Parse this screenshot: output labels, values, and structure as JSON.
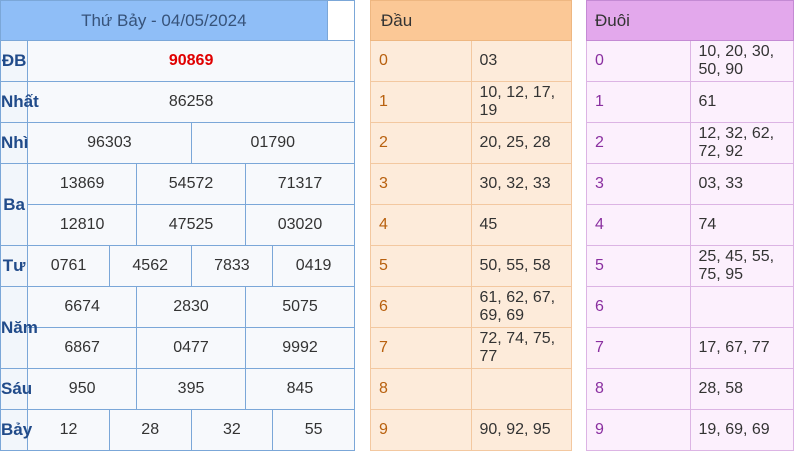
{
  "results": {
    "title": "Thứ Bảy - 04/05/2024",
    "rows": {
      "db": {
        "label": "ĐB",
        "values": [
          "90869"
        ]
      },
      "nhat": {
        "label": "Nhất",
        "values": [
          "86258"
        ]
      },
      "nhi": {
        "label": "Nhì",
        "values": [
          "96303",
          "01790"
        ]
      },
      "ba": {
        "label": "Ba",
        "values": [
          "13869",
          "54572",
          "71317",
          "12810",
          "47525",
          "03020"
        ]
      },
      "tu": {
        "label": "Tư",
        "values": [
          "0761",
          "4562",
          "7833",
          "0419"
        ]
      },
      "nam": {
        "label": "Năm",
        "values": [
          "6674",
          "2830",
          "5075",
          "6867",
          "0477",
          "9992"
        ]
      },
      "sau": {
        "label": "Sáu",
        "values": [
          "950",
          "395",
          "845"
        ]
      },
      "bay": {
        "label": "Bảy",
        "values": [
          "12",
          "28",
          "32",
          "55"
        ]
      }
    }
  },
  "dau": {
    "header": "Đầu",
    "rows": [
      {
        "idx": "0",
        "vals": "03"
      },
      {
        "idx": "1",
        "vals": "10, 12, 17, 19"
      },
      {
        "idx": "2",
        "vals": "20, 25, 28"
      },
      {
        "idx": "3",
        "vals": "30, 32, 33"
      },
      {
        "idx": "4",
        "vals": "45"
      },
      {
        "idx": "5",
        "vals": "50, 55, 58"
      },
      {
        "idx": "6",
        "vals": "61, 62, 67, 69, 69"
      },
      {
        "idx": "7",
        "vals": "72, 74, 75, 77"
      },
      {
        "idx": "8",
        "vals": ""
      },
      {
        "idx": "9",
        "vals": "90, 92, 95"
      }
    ]
  },
  "duoi": {
    "header": "Đuôi",
    "rows": [
      {
        "idx": "0",
        "vals": "10, 20, 30, 50, 90"
      },
      {
        "idx": "1",
        "vals": "61"
      },
      {
        "idx": "2",
        "vals": "12, 32, 62, 72, 92"
      },
      {
        "idx": "3",
        "vals": "03, 33"
      },
      {
        "idx": "4",
        "vals": "74"
      },
      {
        "idx": "5",
        "vals": "25, 45, 55, 75, 95"
      },
      {
        "idx": "6",
        "vals": ""
      },
      {
        "idx": "7",
        "vals": "17, 67, 77"
      },
      {
        "idx": "8",
        "vals": "28, 58"
      },
      {
        "idx": "9",
        "vals": "19, 69, 69"
      }
    ]
  },
  "colors": {
    "special": "#e00000",
    "label": "#214b8a",
    "dau_idx": "#b8600e",
    "duoi_idx": "#8a2fa0"
  }
}
